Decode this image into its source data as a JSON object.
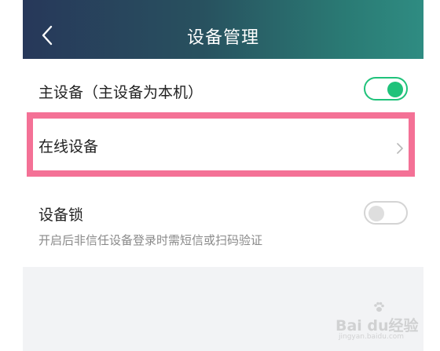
{
  "header": {
    "title": "设备管理"
  },
  "rows": {
    "main_device": {
      "label": "主设备（主设备为本机）",
      "toggle_on": true
    },
    "online_devices": {
      "label": "在线设备"
    },
    "device_lock": {
      "label": "设备锁",
      "description": "开启后非信任设备登录时需短信或扫码验证",
      "toggle_on": false
    }
  },
  "watermark": {
    "brand": "Bai du经验",
    "url": "jingyan.baidu.com"
  },
  "colors": {
    "header_start": "#27385a",
    "header_end": "#2f8c82",
    "toggle_on": "#1fc27a",
    "highlight": "#f47196"
  },
  "icons": [
    "back-arrow-icon",
    "chevron-right-icon",
    "paw-icon"
  ]
}
